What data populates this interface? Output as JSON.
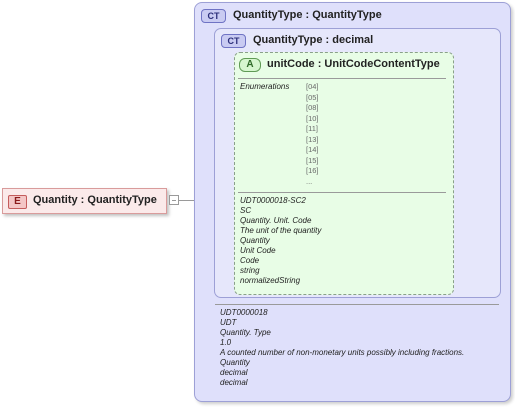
{
  "element": {
    "badge": "E",
    "title": "Quantity : QuantityType"
  },
  "outer_type": {
    "badge": "CT",
    "title": "QuantityType : QuantityType",
    "annotations": [
      "UDT0000018",
      "UDT",
      "Quantity. Type",
      "1.0",
      "A counted number of non-monetary units possibly including fractions.",
      "Quantity",
      "decimal",
      "decimal"
    ]
  },
  "inner_type": {
    "badge": "CT",
    "title": "QuantityType : decimal"
  },
  "attribute": {
    "badge": "A",
    "title": "unitCode : UnitCodeContentType",
    "enum_label": "Enumerations",
    "enums": [
      "[04]",
      "[05]",
      "[08]",
      "[10]",
      "[11]",
      "[13]",
      "[14]",
      "[15]",
      "[16]",
      "..."
    ],
    "annotations": [
      "UDT0000018-SC2",
      "SC",
      "Quantity. Unit. Code",
      "The unit of the quantity",
      "Quantity",
      "Unit Code",
      "Code",
      "string",
      "normalizedString"
    ]
  }
}
